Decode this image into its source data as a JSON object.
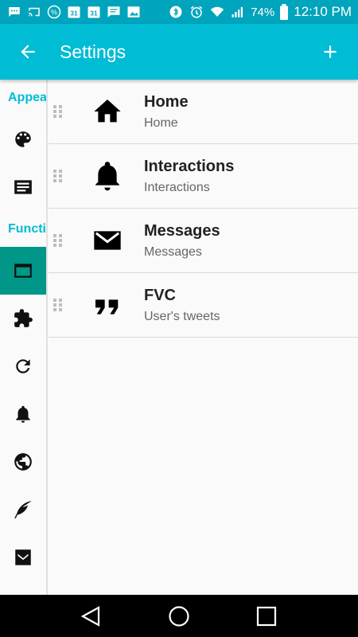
{
  "status_bar": {
    "battery": "74%",
    "time": "12:10 PM",
    "calendar_day_1": "31",
    "calendar_day_2": "31"
  },
  "app_bar": {
    "title": "Settings",
    "back_icon": "arrow-left-icon",
    "add_icon": "plus-icon"
  },
  "sidebar": {
    "sections": [
      {
        "label": "Appearance"
      },
      {
        "label": "Functionality"
      }
    ],
    "items": [
      {
        "icon": "palette-icon",
        "active": false
      },
      {
        "icon": "newspaper-icon",
        "active": false
      },
      {
        "icon": "window-icon",
        "active": true
      },
      {
        "icon": "puzzle-icon",
        "active": false
      },
      {
        "icon": "refresh-icon",
        "active": false
      },
      {
        "icon": "bell-icon",
        "active": false
      },
      {
        "icon": "globe-icon",
        "active": false
      },
      {
        "icon": "feather-icon",
        "active": false
      },
      {
        "icon": "envelope-bird-icon",
        "active": false
      }
    ]
  },
  "columns": [
    {
      "title": "Home",
      "subtitle": "Home",
      "icon": "home-icon"
    },
    {
      "title": "Interactions",
      "subtitle": "Interactions",
      "icon": "bell-icon"
    },
    {
      "title": "Messages",
      "subtitle": "Messages",
      "icon": "mail-icon"
    },
    {
      "title": "FVC",
      "subtitle": "User's tweets",
      "icon": "quote-icon"
    }
  ],
  "colors": {
    "accent": "#00bcd4",
    "status_bar": "#00a4bc",
    "active_sidebar": "#009688"
  }
}
